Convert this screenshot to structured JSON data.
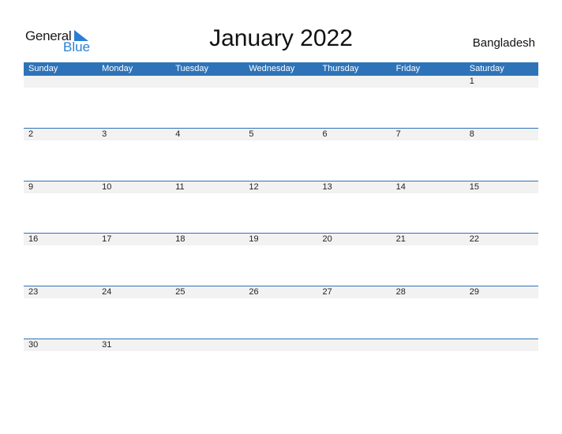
{
  "logo": {
    "word1": "General",
    "word2": "Blue"
  },
  "title": "January 2022",
  "country": "Bangladesh",
  "colors": {
    "accent": "#2e73b8",
    "band": "#f2f2f2",
    "logo_blue": "#2a7fd4"
  },
  "weekdays": [
    "Sunday",
    "Monday",
    "Tuesday",
    "Wednesday",
    "Thursday",
    "Friday",
    "Saturday"
  ],
  "weeks": [
    [
      "",
      "",
      "",
      "",
      "",
      "",
      "1"
    ],
    [
      "2",
      "3",
      "4",
      "5",
      "6",
      "7",
      "8"
    ],
    [
      "9",
      "10",
      "11",
      "12",
      "13",
      "14",
      "15"
    ],
    [
      "16",
      "17",
      "18",
      "19",
      "20",
      "21",
      "22"
    ],
    [
      "23",
      "24",
      "25",
      "26",
      "27",
      "28",
      "29"
    ],
    [
      "30",
      "31",
      "",
      "",
      "",
      "",
      ""
    ]
  ]
}
